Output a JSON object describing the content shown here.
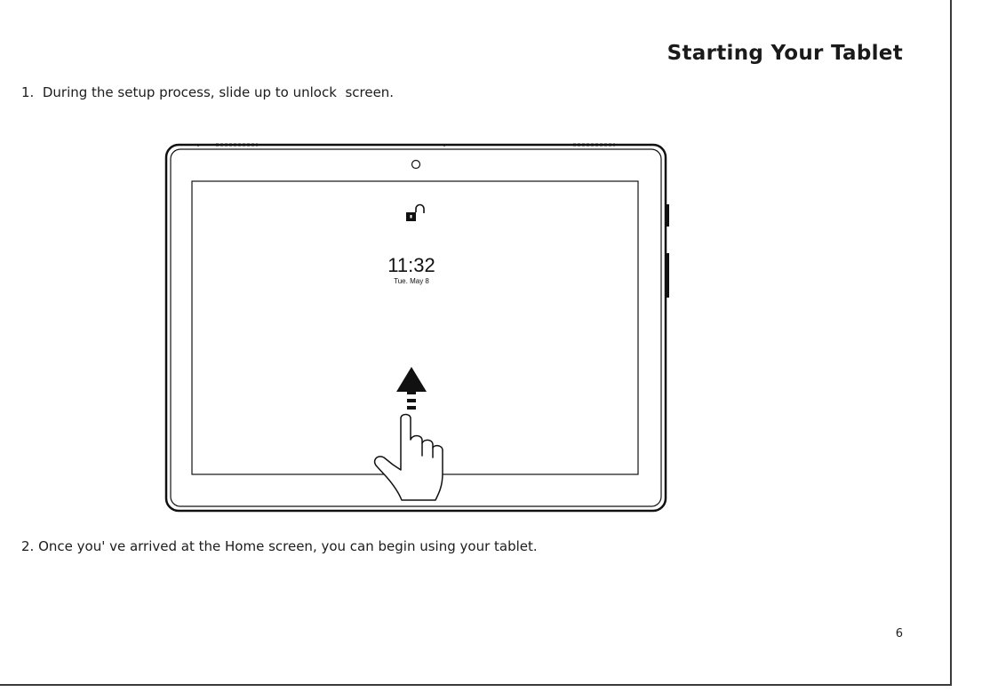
{
  "header": {
    "title": "Starting Your Tablet"
  },
  "steps": [
    {
      "text": "1.  During the setup process, slide up to unlock  screen."
    },
    {
      "text": "2. Once you' ve arrived at the Home screen, you can begin using your tablet."
    }
  ],
  "illustration": {
    "lock_screen": {
      "time": "11:32",
      "date": "Tue. May 8"
    },
    "icons": [
      "camera-icon",
      "unlock-icon",
      "arrow-up-icon",
      "hand-icon"
    ]
  },
  "footer": {
    "page_number": "6"
  }
}
